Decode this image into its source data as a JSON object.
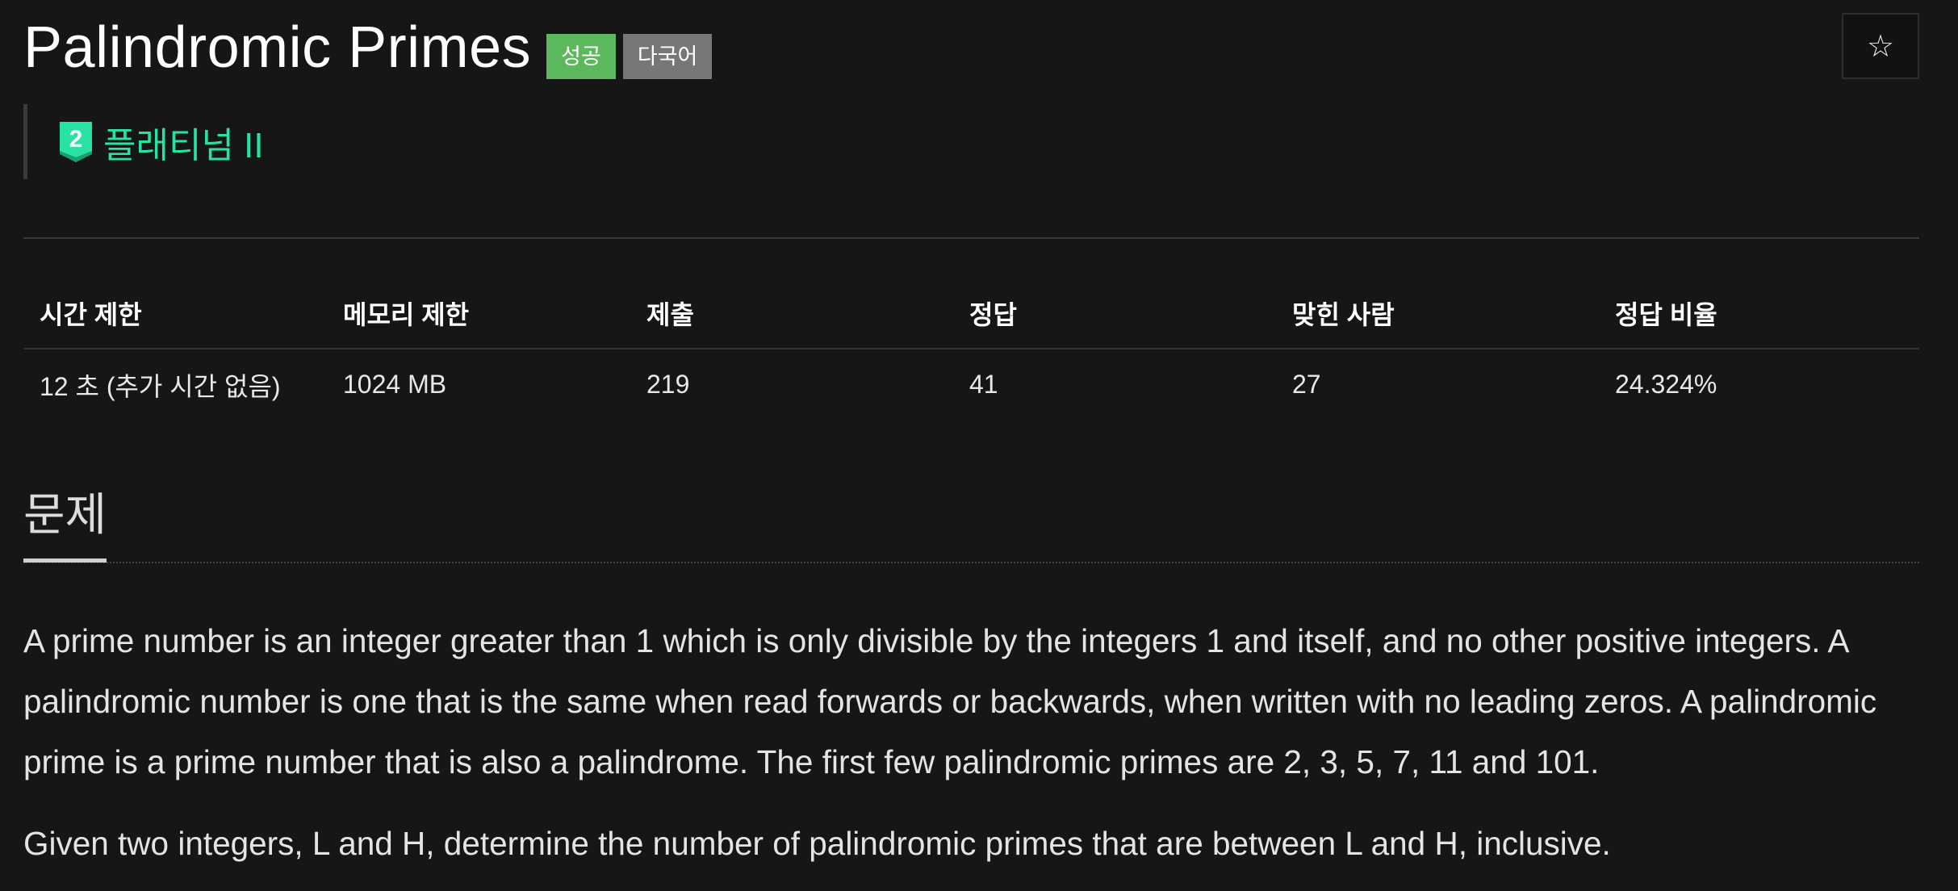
{
  "header": {
    "title": "Palindromic Primes",
    "badge_success": "성공",
    "badge_multilang": "다국어",
    "star_icon": "star-outline-icon"
  },
  "tier": {
    "label": "플래티넘 II",
    "icon_digit": "2",
    "color": "#27e2a4"
  },
  "stats": {
    "headers": [
      "시간 제한",
      "메모리 제한",
      "제출",
      "정답",
      "맞힌 사람",
      "정답 비율"
    ],
    "values": [
      "12 초 (추가 시간 없음)",
      "1024 MB",
      "219",
      "41",
      "27",
      "24.324%"
    ]
  },
  "section": {
    "title": "문제"
  },
  "problem": {
    "paragraphs": [
      "A prime number is an integer greater than 1 which is only divisible by the integers 1 and itself, and no other positive integers. A palindromic number is one that is the same when read forwards or backwards, when written with no leading zeros. A palindromic prime is a prime number that is also a palindrome. The first few palindromic primes are 2, 3, 5, 7, 11 and 101.",
      "Given two integers, L and H, determine the number of palindromic primes that are between L and H, inclusive."
    ]
  },
  "colors": {
    "background": "#161616",
    "success": "#5cb85c",
    "multilang": "#777777"
  }
}
